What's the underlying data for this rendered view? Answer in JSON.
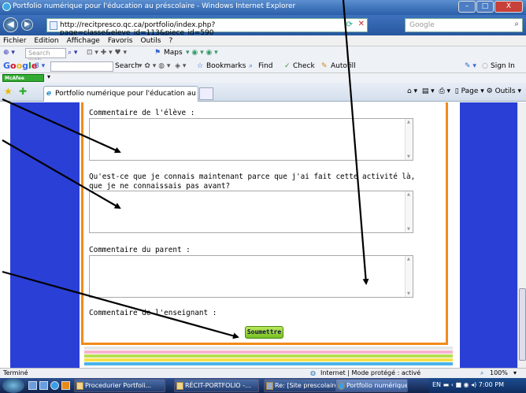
{
  "window": {
    "title": "Portfolio numérique pour l'éducation au préscolaire - Windows Internet Explorer",
    "controls": [
      "–",
      "□",
      "X"
    ]
  },
  "address": {
    "url": "http://recitpresco.qc.ca/portfolio/index.php?page=classe&eleve_id=113&piece_id=590",
    "search_placeholder": "Google"
  },
  "menu": [
    "Fichier",
    "Edition",
    "Affichage",
    "Favoris",
    "Outils",
    "?"
  ],
  "toolbar1": {
    "search_placeholder": "Search web..",
    "maps": "Maps"
  },
  "toolbar2": {
    "google_logo": [
      "G",
      "o",
      "o",
      "g",
      "l",
      "e"
    ],
    "search": "Search",
    "bookmarks": "Bookmarks",
    "find": "Find",
    "check": "Check",
    "autofill": "Autofill",
    "sign_in": "Sign In"
  },
  "toolbar3": {
    "mcafee": "McAfee SiteAdvisor"
  },
  "tabs": [
    {
      "label": "Portfolio numérique pour l'éducation au préscola..."
    }
  ],
  "right_tools": {
    "page": "Page",
    "outils": "Outils"
  },
  "form": {
    "fields": [
      {
        "label": "Commentaire de l'élève :"
      },
      {
        "label_line1": "Qu'est-ce que je connais maintenant parce que j'ai fait cette activité là,",
        "label_line2": "que je ne connaissais pas avant?"
      },
      {
        "label": "Commentaire du parent :"
      },
      {
        "label": "Commentaire de l'enseignant :"
      }
    ],
    "submit_label": "Soumettre",
    "stripe_colors": [
      "#e6e6e6",
      "#f7b3d0",
      "#b7df4f",
      "#f7e04a",
      "#4ab3e8"
    ]
  },
  "status": {
    "left": "Terminé",
    "zone": "Internet | Mode protégé : activé",
    "zoom": "100%"
  },
  "taskbar": {
    "tasks": [
      {
        "label": "Procedurier Portfoli..."
      },
      {
        "label": "RÉCIT-PORTFOLIO -..."
      },
      {
        "label": "Re: [Site prescolaire]..."
      },
      {
        "label": "Portfolio numérique..."
      }
    ],
    "lang": "EN",
    "time": "7:00 PM"
  }
}
